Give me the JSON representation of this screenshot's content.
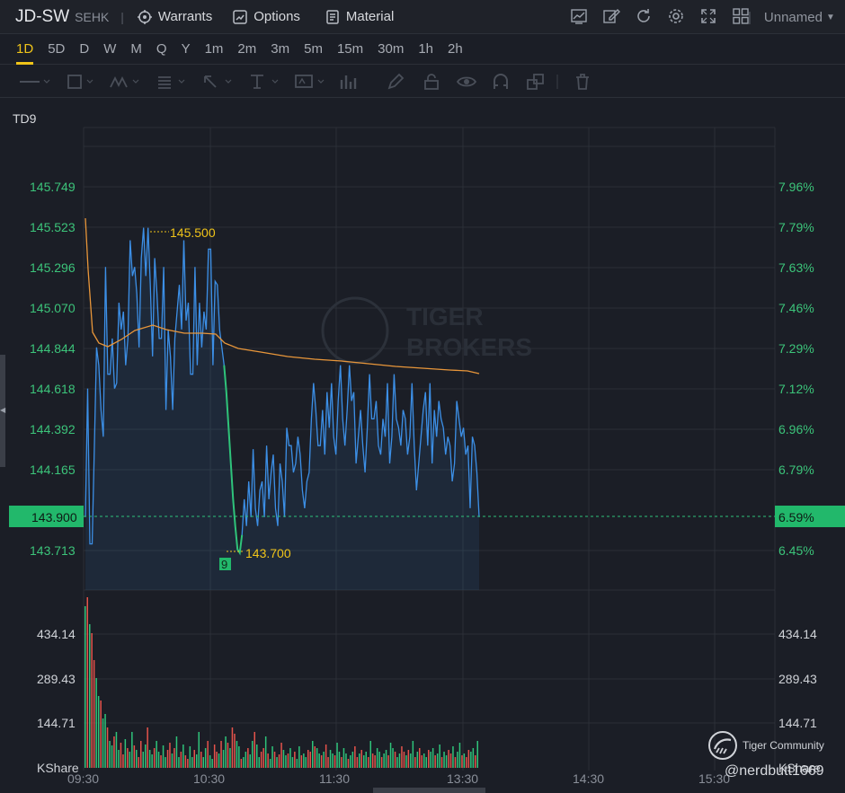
{
  "header": {
    "symbol": "JD-SW",
    "exchange": "SEHK",
    "buttons": [
      {
        "name": "warrants",
        "label": "Warrants"
      },
      {
        "name": "options",
        "label": "Options"
      },
      {
        "name": "material",
        "label": "Material"
      }
    ],
    "layout_name": "Unnamed"
  },
  "periods": [
    "1D",
    "5D",
    "D",
    "W",
    "M",
    "Q",
    "Y",
    "1m",
    "2m",
    "3m",
    "5m",
    "15m",
    "30m",
    "1h",
    "2h"
  ],
  "active_period": "1D",
  "indicator_label": "TD9",
  "colors": {
    "price_line": "#3c8fe6",
    "avg_line": "#e8963a",
    "down_segment": "#2fc37a",
    "label_yellow": "#f0c419",
    "axis_green": "#3cc47a",
    "vol_red": "#e5534b",
    "vol_green": "#2fc37a",
    "current_badge": "#22b86b"
  },
  "chart_data": {
    "type": "line",
    "price_axis": [
      "145.749",
      "145.523",
      "145.296",
      "145.070",
      "144.844",
      "144.618",
      "144.392",
      "144.165",
      "143.900",
      "143.713"
    ],
    "pct_axis": [
      "7.96%",
      "7.79%",
      "7.63%",
      "7.46%",
      "7.29%",
      "7.12%",
      "6.96%",
      "6.79%",
      "6.59%",
      "6.45%"
    ],
    "current_price": "143.900",
    "current_pct": "6.59%",
    "high_label": "145.500",
    "low_label": "143.700",
    "td9_marker": "9",
    "volume_axis": [
      "434.14",
      "289.43",
      "144.71"
    ],
    "volume_unit": "KShare",
    "time_labels": [
      "09:30",
      "10:30",
      "11:30",
      "13:30",
      "14:30",
      "15:30"
    ],
    "ylim": [
      143.6,
      145.95
    ],
    "watermark": [
      "TIGER",
      "BROKERS"
    ]
  },
  "footer": {
    "community": "Tiger Community",
    "handle": "@nerdbutt1669"
  }
}
